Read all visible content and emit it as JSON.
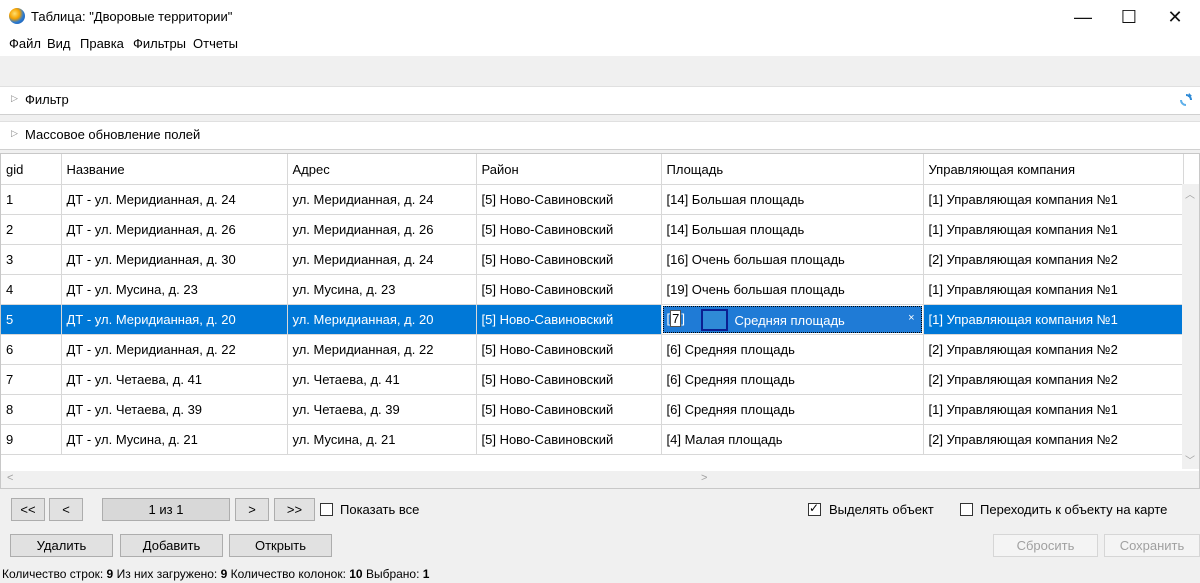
{
  "window": {
    "title": "Таблица: \"Дворовые территории\"",
    "minimize": "—",
    "maximize": "☐",
    "close": "✕"
  },
  "menu": [
    "Файл",
    "Вид",
    "Правка",
    "Фильтры",
    "Отчеты"
  ],
  "filter": {
    "label": "Фильтр"
  },
  "mass_update": {
    "label": "Массовое обновление полей"
  },
  "table": {
    "columns": [
      "gid",
      "Название",
      "Адрес",
      "Район",
      "Площадь",
      "Управляющая компания"
    ],
    "rows": [
      [
        "1",
        "ДТ - ул. Меридианная, д. 24",
        "ул. Меридианная, д. 24",
        "[5]  Ново-Савиновский",
        "[14]  Большая площадь",
        "[1]  Управляющая компания №1"
      ],
      [
        "2",
        "ДТ - ул. Меридианная, д. 26",
        "ул. Меридианная, д. 26",
        "[5]  Ново-Савиновский",
        "[14]  Большая площадь",
        "[1]  Управляющая компания №1"
      ],
      [
        "3",
        "ДТ - ул. Меридианная, д. 30",
        "ул. Меридианная, д. 24",
        "[5]  Ново-Савиновский",
        "[16]  Очень большая площадь",
        "[2]  Управляющая компания №2"
      ],
      [
        "4",
        "ДТ - ул. Мусина, д. 23",
        "ул. Мусина, д. 23",
        "[5]  Ново-Савиновский",
        "[19]  Очень большая площадь",
        "[1]  Управляющая компания №1"
      ],
      [
        "5",
        "ДТ - ул. Меридианная, д. 20",
        "ул. Меридианная, д. 20",
        "[5]  Ново-Савиновский",
        "",
        "[1]  Управляющая компания №1"
      ],
      [
        "6",
        "ДТ - ул. Меридианная, д. 22",
        "ул. Меридианная, д. 22",
        "[5]  Ново-Савиновский",
        "[6]  Средняя площадь",
        "[2]  Управляющая компания №2"
      ],
      [
        "7",
        "ДТ - ул. Четаева, д. 41",
        "ул. Четаева, д. 41",
        "[5]  Ново-Савиновский",
        "[6]  Средняя площадь",
        "[2]  Управляющая компания №2"
      ],
      [
        "8",
        "ДТ - ул. Четаева, д. 39",
        "ул. Четаева, д. 39",
        "[5]  Ново-Савиновский",
        "[6]  Средняя площадь",
        "[1]  Управляющая компания №1"
      ],
      [
        "9",
        "ДТ - ул. Мусина, д. 21",
        "ул. Мусина, д. 21",
        "[5]  Ново-Савиновский",
        "[4]  Малая площадь",
        "[2]  Управляющая компания №2"
      ]
    ],
    "selected_row": 4,
    "editor": {
      "code_open": "[",
      "code_value": "7",
      "code_close": "]",
      "value": "Средняя площадь",
      "clear": "×"
    }
  },
  "pager": {
    "first": "<<",
    "prev": "<",
    "page": "1 из 1",
    "next": ">",
    "last": ">>",
    "show_all": "Показать все"
  },
  "options": {
    "select_object": "Выделять объект",
    "select_object_checked": true,
    "goto_object": "Переходить к объекту на карте",
    "goto_object_checked": false
  },
  "buttons": {
    "delete": "Удалить",
    "add": "Добавить",
    "open": "Открыть",
    "reset": "Сбросить",
    "save": "Сохранить"
  },
  "status": {
    "rows_label": "Количество строк:",
    "rows": "9",
    "loaded_label": "Из них загружено:",
    "loaded": "9",
    "cols_label": "Количество колонок:",
    "cols": "10",
    "selected_label": "Выбрано:",
    "selected": "1"
  },
  "colors": {
    "selection": "#0078d7",
    "swatch": "#2f8ad6"
  }
}
